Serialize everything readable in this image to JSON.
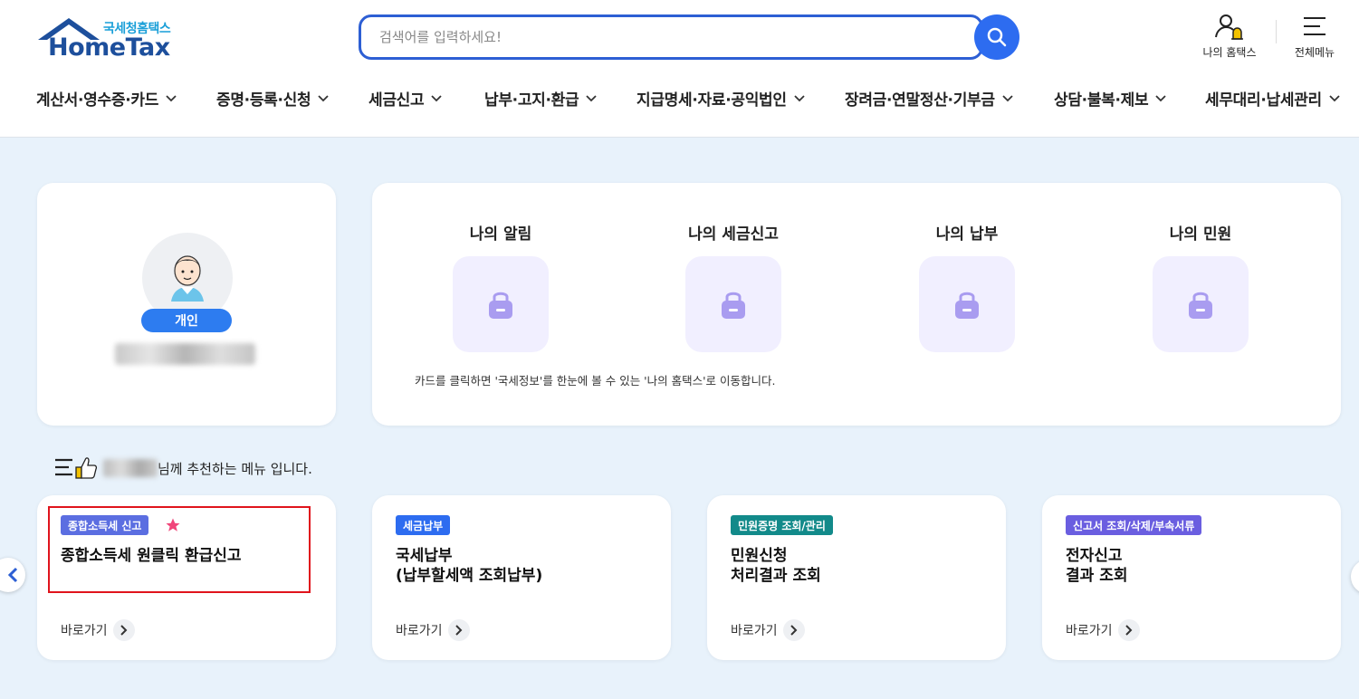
{
  "header": {
    "logo_sub": "국세청홈택스",
    "logo_main": "HomeTax",
    "search_placeholder": "검색어를 입력하세요!",
    "my_hometax": "나의 홈택스",
    "all_menu": "전체메뉴"
  },
  "nav": {
    "items": [
      {
        "label": "계산서·영수증·카드"
      },
      {
        "label": "증명·등록·신청"
      },
      {
        "label": "세금신고"
      },
      {
        "label": "납부·고지·환급"
      },
      {
        "label": "지급명세·자료·공익법인"
      },
      {
        "label": "장려금·연말정산·기부금"
      },
      {
        "label": "상담·불복·제보"
      },
      {
        "label": "세무대리·납세관리"
      }
    ]
  },
  "profile": {
    "badge": "개인"
  },
  "my": {
    "items": [
      {
        "label": "나의 알림"
      },
      {
        "label": "나의 세금신고"
      },
      {
        "label": "나의 납부"
      },
      {
        "label": "나의 민원"
      }
    ],
    "note": "카드를 클릭하면 '국세정보'를 한눈에 볼 수 있는 '나의 홈택스'로 이동합니다."
  },
  "recommend": {
    "suffix": "님께 추천하는 메뉴 입니다.",
    "cards": [
      {
        "tag": "종합소득세 신고",
        "tag_color": "#5b6ee1",
        "title_line1": "종합소득세 원클릭 환급신고",
        "title_line2": "",
        "go": "바로가기"
      },
      {
        "tag": "세금납부",
        "tag_color": "#2d6cf0",
        "title_line1": "국세납부",
        "title_line2": "(납부할세액 조회납부)",
        "go": "바로가기"
      },
      {
        "tag": "민원증명 조회/관리",
        "tag_color": "#128a8a",
        "title_line1": "민원신청",
        "title_line2": "처리결과 조회",
        "go": "바로가기"
      },
      {
        "tag": "신고서 조회/삭제/부속서류",
        "tag_color": "#6a5ee0",
        "title_line1": "전자신고",
        "title_line2": "결과 조회",
        "go": "바로가기"
      }
    ]
  },
  "colors": {
    "accent": "#2d6cf0",
    "background": "#e8f2fb",
    "lock": "#a99cf0",
    "star": "#f0467a",
    "highlight": "#e0141c"
  }
}
